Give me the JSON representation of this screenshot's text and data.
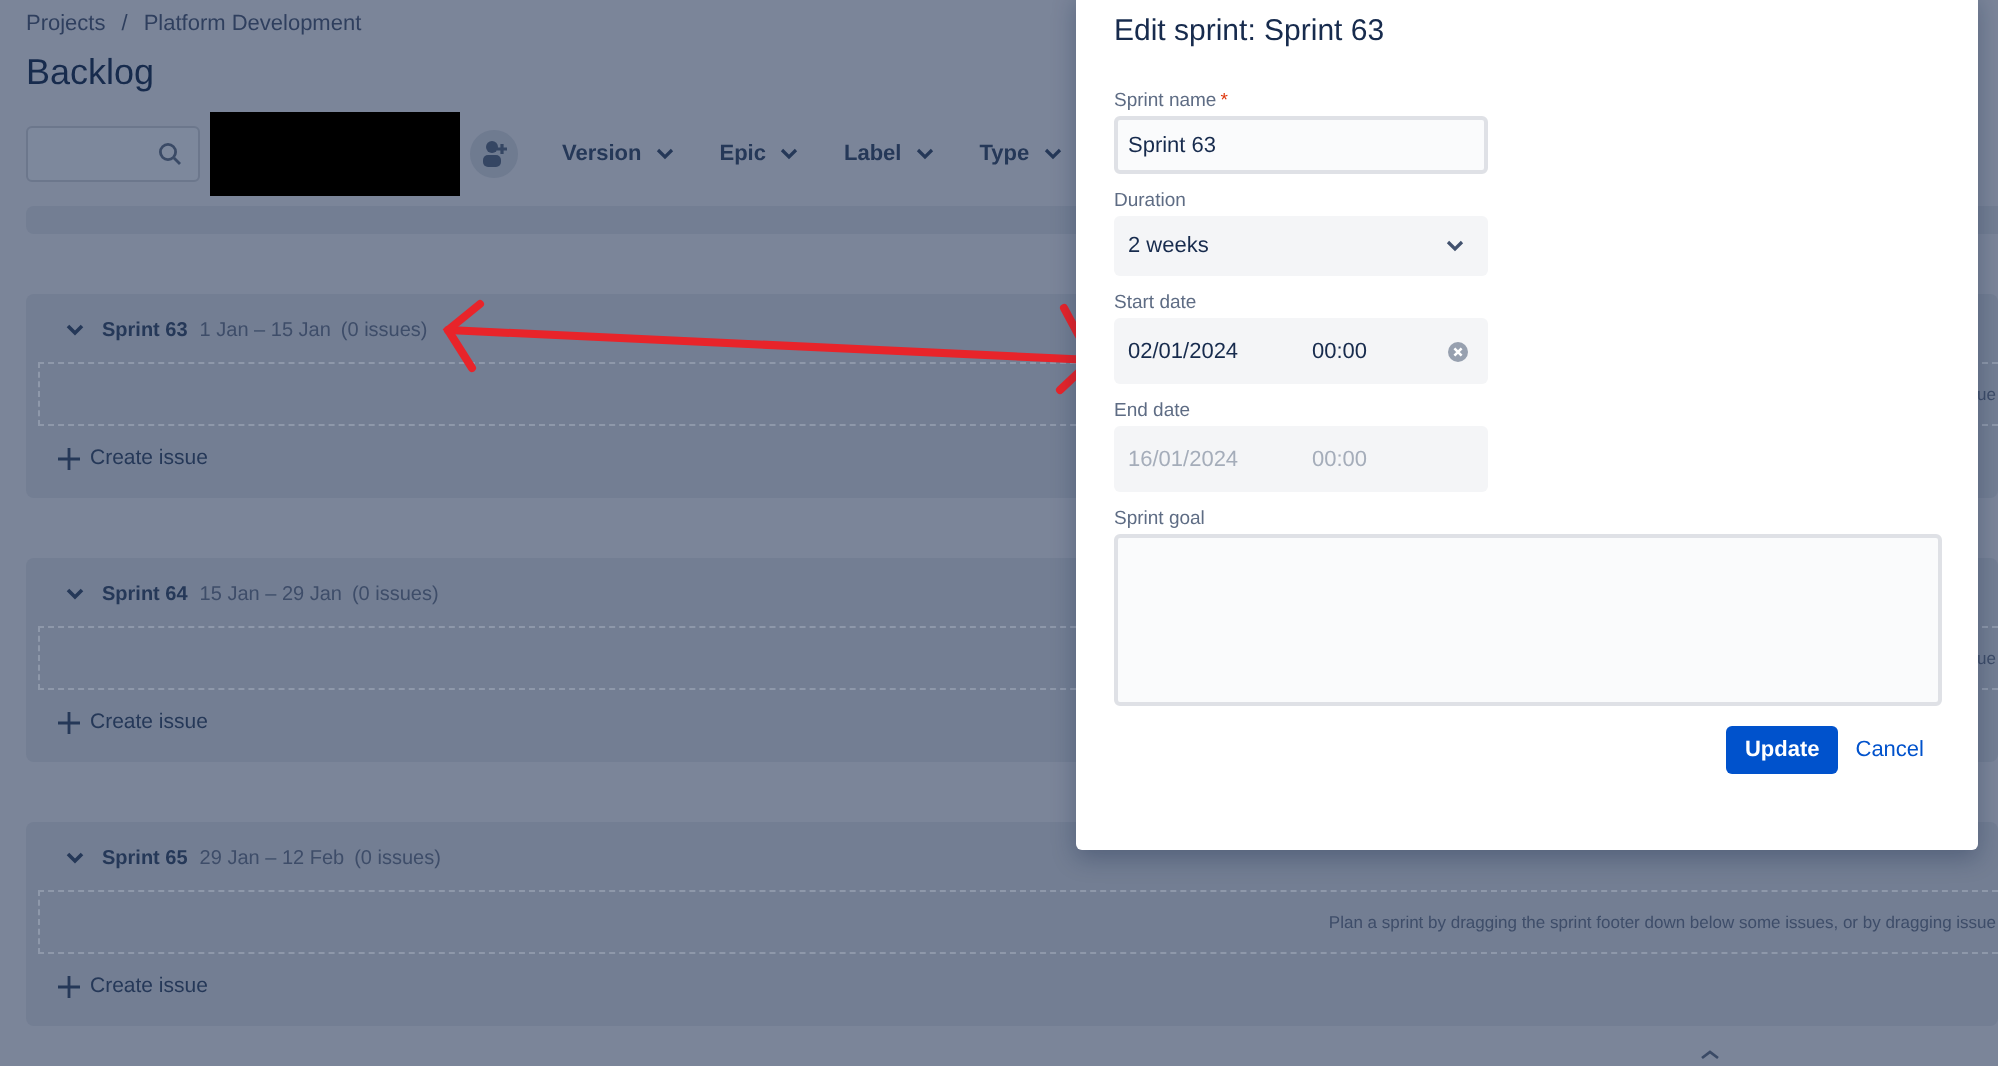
{
  "breadcrumb": {
    "items": [
      "Projects",
      "Platform Development"
    ],
    "separator": "/"
  },
  "title": "Backlog",
  "filters": [
    "Version",
    "Epic",
    "Label",
    "Type"
  ],
  "sprints": [
    {
      "name": "Sprint 63",
      "dates": "1 Jan – 15 Jan",
      "count": "(0 issues)",
      "expanded": true,
      "hint": "ue",
      "create": "Create issue"
    },
    {
      "name": "Sprint 64",
      "dates": "15 Jan – 29 Jan",
      "count": "(0 issues)",
      "expanded": true,
      "hint": "ue",
      "create": "Create issue"
    },
    {
      "name": "Sprint 65",
      "dates": "29 Jan – 12 Feb",
      "count": "(0 issues)",
      "expanded": true,
      "hint": "Plan a sprint by dragging the sprint footer down below some issues, or by dragging issue",
      "create": "Create issue"
    }
  ],
  "modal": {
    "title": "Edit sprint: Sprint 63",
    "fields": [
      {
        "kind": "text",
        "label": "Sprint name",
        "required_mark": "*",
        "value": "Sprint 63"
      },
      {
        "kind": "select",
        "label": "Duration",
        "value": "2 weeks"
      },
      {
        "kind": "datetime",
        "label": "Start date",
        "date": "02/01/2024",
        "time": "00:00",
        "disabled": false,
        "clearable": true
      },
      {
        "kind": "datetime",
        "label": "End date",
        "date": "16/01/2024",
        "time": "00:00",
        "disabled": true
      },
      {
        "kind": "textarea",
        "label": "Sprint goal"
      }
    ],
    "buttons": [
      {
        "kind": "primary",
        "label": "Update"
      },
      {
        "kind": "link",
        "label": "Cancel"
      }
    ]
  }
}
